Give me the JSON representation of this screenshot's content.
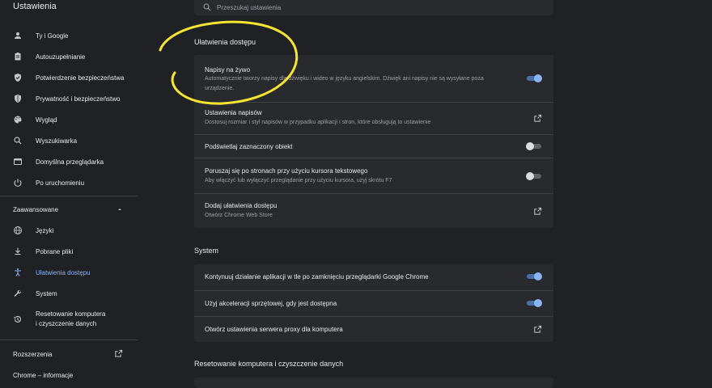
{
  "app": {
    "title": "Ustawienia"
  },
  "search": {
    "placeholder": "Przeszukaj ustawienia"
  },
  "sidebar": {
    "items": [
      {
        "label": "Ty i Google",
        "icon": "person-icon"
      },
      {
        "label": "Autouzupełnianie",
        "icon": "clipboard-icon"
      },
      {
        "label": "Potwierdzenie bezpieczeństwa",
        "icon": "shield-check-icon"
      },
      {
        "label": "Prywatność i bezpieczeństwo",
        "icon": "shield-icon"
      },
      {
        "label": "Wygląd",
        "icon": "palette-icon"
      },
      {
        "label": "Wyszukiwarka",
        "icon": "search-icon"
      },
      {
        "label": "Domyślna przeglądarka",
        "icon": "browser-icon"
      },
      {
        "label": "Po uruchomieniu",
        "icon": "power-icon"
      }
    ],
    "advanced_label": "Zaawansowane",
    "advanced_items": [
      {
        "label": "Języki",
        "icon": "globe-icon"
      },
      {
        "label": "Pobrane pliki",
        "icon": "download-icon"
      },
      {
        "label": "Ułatwienia dostępu",
        "icon": "accessibility-icon",
        "active": true
      },
      {
        "label": "System",
        "icon": "wrench-icon"
      },
      {
        "label": "Resetowanie komputera",
        "label2": "i czyszczenie danych",
        "icon": "history-icon"
      }
    ],
    "extensions_label": "Rozszerzenia",
    "about_label": "Chrome – informacje"
  },
  "accessibility": {
    "title": "Ułatwienia dostępu",
    "rows": [
      {
        "title": "Napisy na żywo",
        "desc": "Automatycznie tworzy napisy dla dźwięku i wideo w języku angielskim. Dźwięk ani napisy nie są wysyłane poza urządzenie.",
        "control": "toggle",
        "on": true
      },
      {
        "title": "Ustawienia napisów",
        "desc": "Dostosuj rozmiar i styl napisów w przypadku aplikacji i stron, które obsługują to ustawienie",
        "control": "external"
      },
      {
        "title": "Podświetlaj zaznaczony obiekt",
        "control": "toggle",
        "on": false
      },
      {
        "title": "Poruszaj się po stronach przy użyciu kursora tekstowego",
        "desc": "Aby włączyć lub wyłączyć przeglądanie przy użyciu kursora, użyj skrótu F7",
        "control": "toggle",
        "on": false
      },
      {
        "title": "Dodaj ułatwienia dostępu",
        "desc": "Otwórz Chrome Web Store",
        "control": "external"
      }
    ]
  },
  "system": {
    "title": "System",
    "rows": [
      {
        "title": "Kontynuuj działanie aplikacji w tle po zamknięciu przeglądarki Google Chrome",
        "control": "toggle",
        "on": true
      },
      {
        "title": "Użyj akceleracji sprzętowej, gdy jest dostępna",
        "control": "toggle",
        "on": true
      },
      {
        "title": "Otwórz ustawienia serwera proxy dla komputera",
        "control": "external"
      }
    ]
  },
  "reset": {
    "title": "Resetowanie komputera i czyszczenie danych"
  },
  "colors": {
    "background": "#202124",
    "card": "#292a2d",
    "accent": "#8ab4f8",
    "annotation": "#f6e531"
  }
}
